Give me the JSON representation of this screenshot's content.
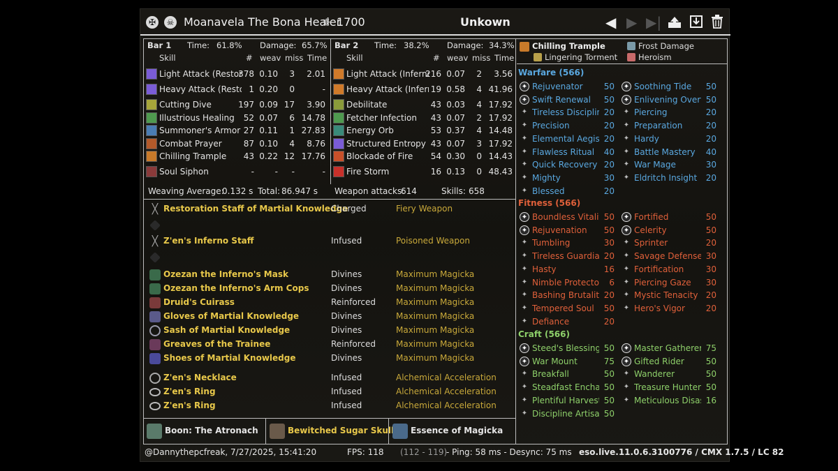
{
  "title": {
    "char_name": "Moanavela The Bona Healer",
    "cp": "1700",
    "fight": "Unkown"
  },
  "bars": [
    {
      "label": "Bar 1",
      "time_label": "Time:",
      "time": "61.8%",
      "damage_label": "Damage:",
      "damage": "65.7%",
      "cols": {
        "skill": "Skill",
        "count": "#",
        "weav": "weav",
        "miss": "miss",
        "time": "Time"
      },
      "rows": [
        {
          "name": "Light Attack (Restorat",
          "count": "378",
          "weav": "0.10",
          "miss": "3",
          "time": "2.01",
          "color": "#7a5cd6"
        },
        {
          "name": "Heavy Attack (Restor",
          "count": "1",
          "weav": "0.20",
          "miss": "0",
          "time": "-",
          "color": "#7a5cd6"
        },
        {
          "name": "Cutting Dive",
          "count": "197",
          "weav": "0.09",
          "miss": "17",
          "time": "3.90",
          "color": "#a7a63a"
        },
        {
          "name": "Illustrious Healing",
          "count": "52",
          "weav": "0.07",
          "miss": "6",
          "time": "14.78",
          "color": "#4f9a4f"
        },
        {
          "name": "Summoner's Armor",
          "count": "27",
          "weav": "0.11",
          "miss": "1",
          "time": "27.83",
          "color": "#4a7db3"
        },
        {
          "name": "Combat Prayer",
          "count": "87",
          "weav": "0.10",
          "miss": "4",
          "time": "8.76",
          "color": "#b35a2a"
        },
        {
          "name": "Chilling Trample",
          "count": "43",
          "weav": "0.22",
          "miss": "12",
          "time": "17.76",
          "color": "#c87a2a"
        },
        {
          "name": "Soul Siphon",
          "count": "-",
          "weav": "-",
          "miss": "-",
          "time": "-",
          "color": "#8a3a3a"
        }
      ]
    },
    {
      "label": "Bar 2",
      "time_label": "Time:",
      "time": "38.2%",
      "damage_label": "Damage:",
      "damage": "34.3%",
      "cols": {
        "skill": "Skill",
        "count": "#",
        "weav": "weav",
        "miss": "miss",
        "time": "Time"
      },
      "rows": [
        {
          "name": "Light Attack (Inferno)",
          "count": "216",
          "weav": "0.07",
          "miss": "2",
          "time": "3.56",
          "color": "#d07a2a"
        },
        {
          "name": "Heavy Attack (Inferno",
          "count": "19",
          "weav": "0.58",
          "miss": "4",
          "time": "41.96",
          "color": "#d07a2a"
        },
        {
          "name": "Debilitate",
          "count": "43",
          "weav": "0.03",
          "miss": "4",
          "time": "17.92",
          "color": "#8a9a3a"
        },
        {
          "name": "Fetcher Infection",
          "count": "43",
          "weav": "0.07",
          "miss": "2",
          "time": "17.92",
          "color": "#4f9a4f"
        },
        {
          "name": "Energy Orb",
          "count": "53",
          "weav": "0.37",
          "miss": "4",
          "time": "14.48",
          "color": "#3a8a7a"
        },
        {
          "name": "Structured Entropy",
          "count": "43",
          "weav": "0.07",
          "miss": "3",
          "time": "17.92",
          "color": "#7a5cd6"
        },
        {
          "name": "Blockade of Fire",
          "count": "54",
          "weav": "0.30",
          "miss": "0",
          "time": "14.43",
          "color": "#c8502a"
        },
        {
          "name": "Fire Storm",
          "count": "16",
          "weav": "0.13",
          "miss": "0",
          "time": "48.43",
          "color": "#c8302a"
        }
      ]
    }
  ],
  "summary": {
    "weaving_label": "Weaving Average:",
    "weaving": "0.132 s",
    "total_label": "Total:",
    "total": "86.947 s",
    "weapon_label": "Weapon attacks:",
    "weapon": "614",
    "skills_label": "Skills:",
    "skills": "658"
  },
  "gear": [
    {
      "name": "Restoration Staff of Martial Knowledge",
      "trait": "Charged",
      "enchant": "Fiery Weapon",
      "icon": "staff"
    },
    {
      "name": "",
      "trait": "",
      "enchant": "",
      "icon": "empty"
    },
    {
      "name": "Z'en's Inferno Staff",
      "trait": "Infused",
      "enchant": "Poisoned Weapon",
      "icon": "staff"
    },
    {
      "name": "",
      "trait": "",
      "enchant": "",
      "icon": "empty"
    },
    {
      "name": "Ozezan the Inferno's Mask",
      "trait": "Divines",
      "enchant": "Maximum Magicka",
      "icon": "mask"
    },
    {
      "name": "Ozezan the Inferno's Arm Cops",
      "trait": "Divines",
      "enchant": "Maximum Magicka",
      "icon": "mask"
    },
    {
      "name": "Druid's Cuirass",
      "trait": "Reinforced",
      "enchant": "Maximum Magicka",
      "icon": "chest"
    },
    {
      "name": "Gloves of Martial Knowledge",
      "trait": "Divines",
      "enchant": "Maximum Magicka",
      "icon": "gloves"
    },
    {
      "name": "Sash of Martial Knowledge",
      "trait": "Divines",
      "enchant": "Maximum Magicka",
      "icon": "sash"
    },
    {
      "name": "Greaves of the Trainee",
      "trait": "Reinforced",
      "enchant": "Maximum Magicka",
      "icon": "legs"
    },
    {
      "name": "Shoes of Martial Knowledge",
      "trait": "Divines",
      "enchant": "Maximum Magicka",
      "icon": "shoes"
    },
    {
      "name": "Z'en's Necklace",
      "trait": "Infused",
      "enchant": "Alchemical Acceleration",
      "icon": "necklace"
    },
    {
      "name": "Z'en's Ring",
      "trait": "Infused",
      "enchant": "Alchemical Acceleration",
      "icon": "ring"
    },
    {
      "name": "Z'en's Ring",
      "trait": "Infused",
      "enchant": "Alchemical Acceleration",
      "icon": "ring"
    }
  ],
  "boons": [
    {
      "name": "Boon: The Atronach",
      "color": "#e8e8e8"
    },
    {
      "name": "Bewitched Sugar Skulls",
      "color": "#e8c84a"
    },
    {
      "name": "Essence of Magicka",
      "color": "#e8e8e8"
    }
  ],
  "sets": {
    "slot1_title": "Chilling Trample",
    "slot1_sub": "Lingering Torment",
    "slot2_title": "Frost Damage",
    "slot2_sub": "Heroism"
  },
  "cp_trees": [
    {
      "title": "Warfare (566)",
      "color": "#5aa8e0",
      "left": [
        {
          "name": "Rejuvenator",
          "value": "50",
          "slotted": true
        },
        {
          "name": "Swift Renewal",
          "value": "50",
          "slotted": true
        },
        {
          "name": "Tireless Disciplin",
          "value": "20",
          "slotted": false
        },
        {
          "name": "Precision",
          "value": "20",
          "slotted": false
        },
        {
          "name": "Elemental Aegis",
          "value": "20",
          "slotted": false
        },
        {
          "name": "Flawless Ritual",
          "value": "40",
          "slotted": false
        },
        {
          "name": "Quick Recovery",
          "value": "20",
          "slotted": false
        },
        {
          "name": "Mighty",
          "value": "30",
          "slotted": false
        },
        {
          "name": "Blessed",
          "value": "20",
          "slotted": false
        }
      ],
      "right": [
        {
          "name": "Soothing Tide",
          "value": "50",
          "slotted": true
        },
        {
          "name": "Enlivening Overfl",
          "value": "50",
          "slotted": true
        },
        {
          "name": "Piercing",
          "value": "20",
          "slotted": false
        },
        {
          "name": "Preparation",
          "value": "20",
          "slotted": false
        },
        {
          "name": "Hardy",
          "value": "20",
          "slotted": false
        },
        {
          "name": "Battle Mastery",
          "value": "40",
          "slotted": false
        },
        {
          "name": "War Mage",
          "value": "30",
          "slotted": false
        },
        {
          "name": "Eldritch Insight",
          "value": "20",
          "slotted": false
        }
      ]
    },
    {
      "title": "Fitness (566)",
      "color": "#e0603a",
      "left": [
        {
          "name": "Boundless Vitality",
          "value": "50",
          "slotted": true
        },
        {
          "name": "Rejuvenation",
          "value": "50",
          "slotted": true
        },
        {
          "name": "Tumbling",
          "value": "30",
          "slotted": false
        },
        {
          "name": "Tireless Guardian",
          "value": "20",
          "slotted": false
        },
        {
          "name": "Hasty",
          "value": "16",
          "slotted": false
        },
        {
          "name": "Nimble Protector",
          "value": "6",
          "slotted": false
        },
        {
          "name": "Bashing Brutality",
          "value": "20",
          "slotted": false
        },
        {
          "name": "Tempered Soul",
          "value": "50",
          "slotted": false
        },
        {
          "name": "Defiance",
          "value": "20",
          "slotted": false
        }
      ],
      "right": [
        {
          "name": "Fortified",
          "value": "50",
          "slotted": true
        },
        {
          "name": "Celerity",
          "value": "50",
          "slotted": true
        },
        {
          "name": "Sprinter",
          "value": "20",
          "slotted": false
        },
        {
          "name": "Savage Defense",
          "value": "30",
          "slotted": false
        },
        {
          "name": "Fortification",
          "value": "30",
          "slotted": false
        },
        {
          "name": "Piercing Gaze",
          "value": "30",
          "slotted": false
        },
        {
          "name": "Mystic Tenacity",
          "value": "20",
          "slotted": false
        },
        {
          "name": "Hero's Vigor",
          "value": "20",
          "slotted": false
        }
      ]
    },
    {
      "title": "Craft (566)",
      "color": "#8ed06a",
      "left": [
        {
          "name": "Steed's Blessing",
          "value": "50",
          "slotted": true
        },
        {
          "name": "War Mount",
          "value": "75",
          "slotted": true
        },
        {
          "name": "Breakfall",
          "value": "50",
          "slotted": false
        },
        {
          "name": "Steadfast Enchan",
          "value": "50",
          "slotted": false
        },
        {
          "name": "Plentiful Harvest",
          "value": "50",
          "slotted": false
        },
        {
          "name": "Discipline Artisan",
          "value": "50",
          "slotted": false
        }
      ],
      "right": [
        {
          "name": "Master Gatherer",
          "value": "75",
          "slotted": true
        },
        {
          "name": "Gifted Rider",
          "value": "50",
          "slotted": true
        },
        {
          "name": "Wanderer",
          "value": "50",
          "slotted": false
        },
        {
          "name": "Treasure Hunter",
          "value": "50",
          "slotted": false
        },
        {
          "name": "Meticulous Disas",
          "value": "16",
          "slotted": false
        }
      ]
    }
  ],
  "footer": {
    "user": "@Dannythepcfreak, 7/27/2025, 15:41:20",
    "fps_label": "FPS: 118",
    "fps_range": "(112 - 119)",
    "ping": "- Ping: 58 ms - Desync: 75 ms",
    "version": "eso.live.11.0.6.3100776 / CMX 1.7.5 / LC 82"
  },
  "icons": {
    "title_left1": "guild-crest-icon",
    "title_left2": "skull-class-icon",
    "cp": "champion-point-icon",
    "prev": "arrow-left-icon",
    "next": "arrow-right-icon",
    "last": "arrow-skip-icon",
    "upload": "upload-icon",
    "save": "save-icon",
    "delete": "trash-icon"
  }
}
